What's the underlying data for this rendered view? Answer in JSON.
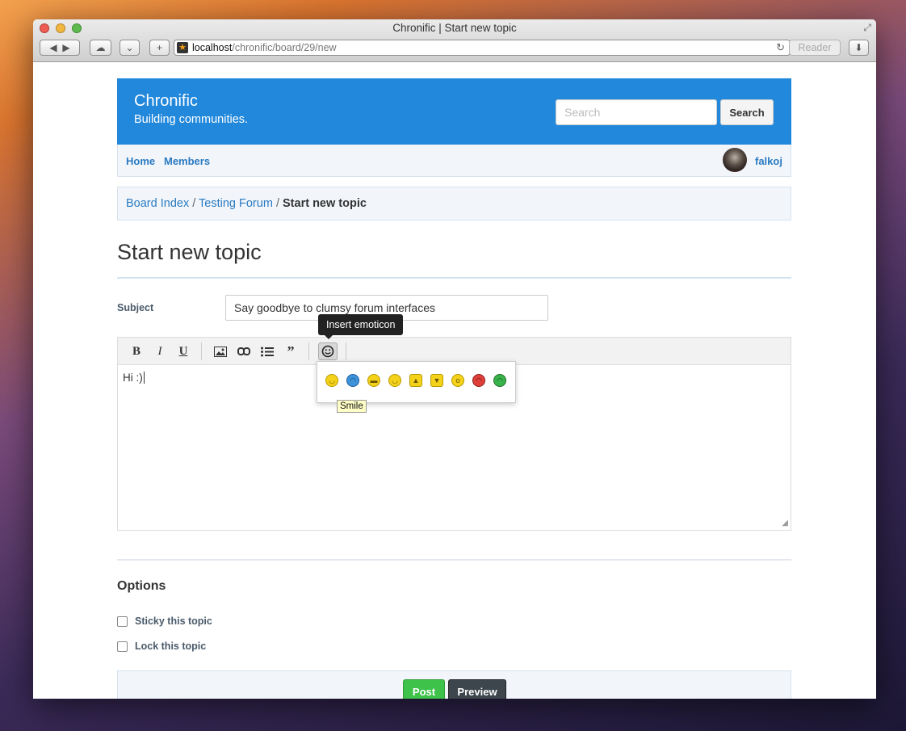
{
  "browser": {
    "window_title": "Chronific | Start new topic",
    "url_host": "localhost",
    "url_path": "/chronific/board/29/new",
    "reader_label": "Reader"
  },
  "site": {
    "name": "Chronific",
    "tagline": "Building communities.",
    "search_placeholder": "Search",
    "search_button": "Search",
    "nav": [
      "Home",
      "Members"
    ],
    "username": "falkoj"
  },
  "breadcrumb": {
    "items": [
      "Board Index",
      "Testing Forum"
    ],
    "current": "Start new topic"
  },
  "page_title": "Start new topic",
  "form": {
    "subject_label": "Subject",
    "subject_value": "Say goodbye to clumsy forum interfaces",
    "editor_text": "Hi :)",
    "tooltip": "Insert emoticon",
    "emoticon_hover_label": "Smile",
    "emoticons": [
      {
        "name": "smile",
        "color": "#f4d21a"
      },
      {
        "name": "sad",
        "color": "#3d92d8"
      },
      {
        "name": "grin",
        "color": "#f4d21a"
      },
      {
        "name": "wink",
        "color": "#f4d21a"
      },
      {
        "name": "thumbs-up",
        "color": "#f4d21a"
      },
      {
        "name": "thumbs-down",
        "color": "#f4d21a"
      },
      {
        "name": "surprised",
        "color": "#f4d21a"
      },
      {
        "name": "angry",
        "color": "#e0403a"
      },
      {
        "name": "sick",
        "color": "#3ab34a"
      }
    ]
  },
  "options": {
    "heading": "Options",
    "sticky_label": "Sticky this topic",
    "lock_label": "Lock this topic"
  },
  "actions": {
    "post": "Post",
    "preview": "Preview"
  },
  "colors": {
    "brand": "#2188dc",
    "post": "#3fc24a",
    "preview": "#3d464d"
  }
}
